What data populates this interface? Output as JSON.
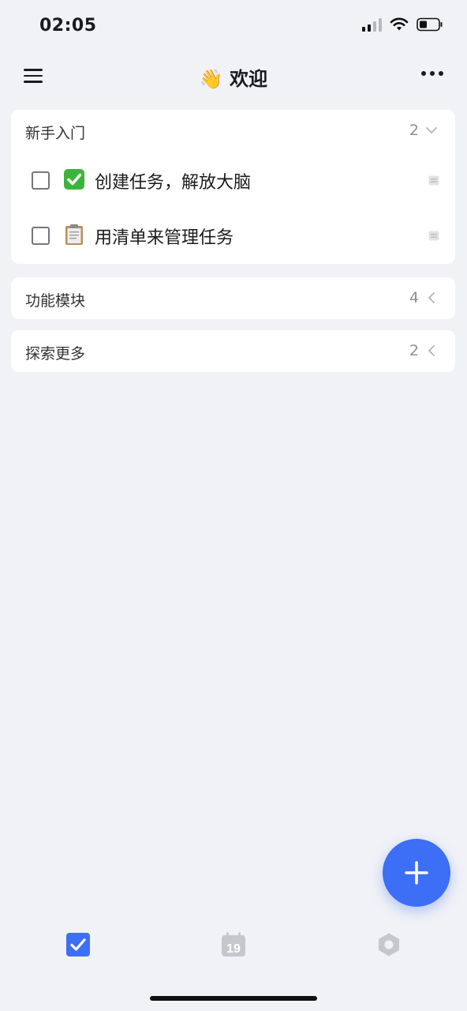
{
  "status_bar": {
    "time": "02:05"
  },
  "nav": {
    "title": "👋 欢迎"
  },
  "groups": [
    {
      "title": "新手入门",
      "count": "2",
      "expanded": true,
      "tasks": [
        {
          "emoji_icon": "check-mark-button-icon",
          "title": "创建任务，解放大脑"
        },
        {
          "emoji_icon": "clipboard-icon",
          "title": "用清单来管理任务"
        }
      ]
    },
    {
      "title": "功能模块",
      "count": "4",
      "expanded": false
    },
    {
      "title": "探索更多",
      "count": "2",
      "expanded": false
    }
  ],
  "tabbar": {
    "tabs": [
      {
        "icon": "tasks-checkbox-icon",
        "active": true
      },
      {
        "icon": "calendar-icon",
        "active": false,
        "calendar_day": "19"
      },
      {
        "icon": "settings-icon",
        "active": false
      }
    ]
  },
  "colors": {
    "accent": "#3d6ef6",
    "background": "#f1f2f6",
    "card": "#ffffff",
    "inactive_icon": "#c6c7cc"
  }
}
